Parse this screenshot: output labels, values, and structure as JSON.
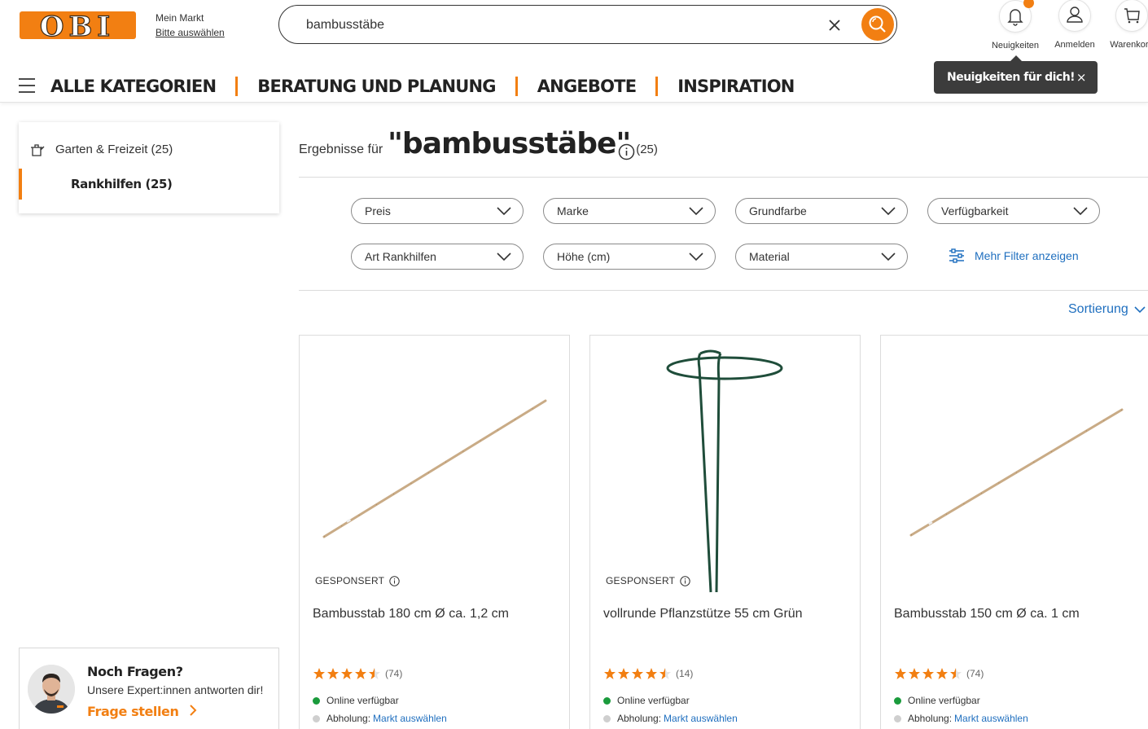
{
  "header": {
    "logo_text": "OBI",
    "market_title": "Mein Markt",
    "market_link": "Bitte auswählen",
    "search_value": "bambusstäbe",
    "icons": [
      {
        "name": "bell-icon",
        "label": "Neuigkeiten"
      },
      {
        "name": "user-icon",
        "label": "Anmelden"
      },
      {
        "name": "cart-icon",
        "label": "Warenkorb"
      }
    ],
    "tooltip": "Neuigkeiten für dich!",
    "tooltip_close": "×"
  },
  "nav": [
    "ALLE KATEGORIEN",
    "BERATUNG UND PLANUNG",
    "ANGEBOTE",
    "INSPIRATION"
  ],
  "sidebar": {
    "category": "Garten & Freizeit (25)",
    "subcategory": "Rankhilfen (25)",
    "help_title": "Noch Fragen?",
    "help_text": "Unsere Expert:innen antworten dir!",
    "help_link": "Frage stellen"
  },
  "results": {
    "prefix": "Ergebnisse für",
    "query": "\"bambusstäbe\"",
    "count": "(25)"
  },
  "filters": [
    "Preis",
    "Marke",
    "Grundfarbe",
    "Verfügbarkeit",
    "Art Rankhilfen",
    "Höhe (cm)",
    "Material"
  ],
  "more_filters": "Mehr Filter anzeigen",
  "sort_label": "Sortierung",
  "products": [
    {
      "sponsored": "GESPONSERT",
      "name": "Bambusstab 180 cm Ø ca. 1,2 cm",
      "rating": 4.5,
      "reviews": "(74)",
      "online": "Online verfügbar",
      "pickup": "Abholung:",
      "pickup_link": "Markt auswählen"
    },
    {
      "sponsored": "GESPONSERT",
      "name": "vollrunde Pflanzstütze 55 cm Grün",
      "rating": 4.5,
      "reviews": "(14)",
      "online": "Online verfügbar",
      "pickup": "Abholung:",
      "pickup_link": "Markt auswählen"
    },
    {
      "sponsored": "",
      "name": "Bambusstab 150 cm Ø ca. 1 cm",
      "rating": 4.5,
      "reviews": "(74)",
      "online": "Online verfügbar",
      "pickup": "Abholung:",
      "pickup_link": "Markt auswählen"
    }
  ],
  "colors": {
    "brand": "#f27f12",
    "link": "#1f6fbf",
    "available": "#1a9b3c",
    "unavailable": "#cfcfcf"
  }
}
